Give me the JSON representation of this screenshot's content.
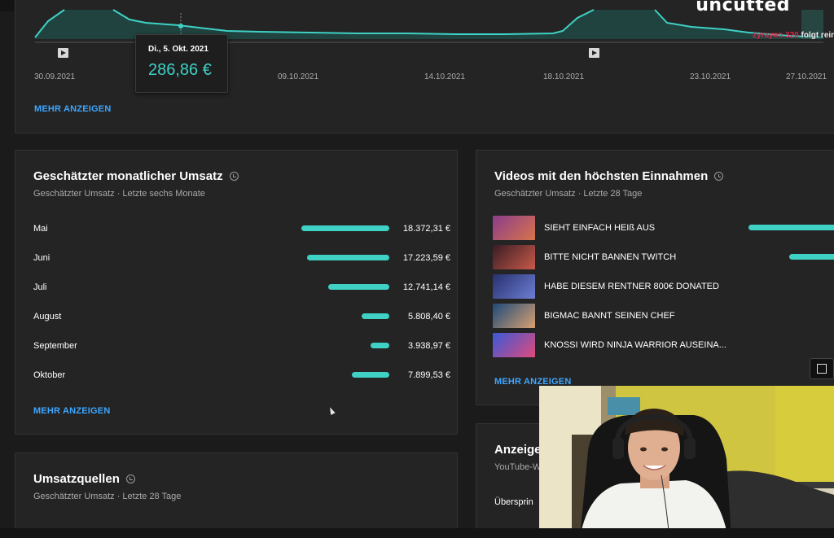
{
  "brand": {
    "name": "uncutted"
  },
  "revenue_chart": {
    "tooltip": {
      "date": "Di., 5. Okt. 2021",
      "value": "286,86 €"
    },
    "x_ticks": [
      "30.09.2021",
      "09.10.2021",
      "14.10.2021",
      "18.10.2021",
      "23.10.2021",
      "27.10.2021"
    ],
    "overlay": {
      "name": "zyrayen",
      "amount": "320",
      "suffix": "folgt rein"
    },
    "more_label": "MEHR ANZEIGEN"
  },
  "monthly_revenue": {
    "title": "Geschätzter monatlicher Umsatz",
    "subtitle": "Geschätzter Umsatz · Letzte sechs Monate",
    "more_label": "MEHR ANZEIGEN",
    "rows": [
      {
        "month": "Mai",
        "value_label": "18.372,31 €",
        "amount": 18372.31
      },
      {
        "month": "Juni",
        "value_label": "17.223,59 €",
        "amount": 17223.59
      },
      {
        "month": "Juli",
        "value_label": "12.741,14 €",
        "amount": 12741.14
      },
      {
        "month": "August",
        "value_label": "5.808,40 €",
        "amount": 5808.4
      },
      {
        "month": "September",
        "value_label": "3.938,97 €",
        "amount": 3938.97
      },
      {
        "month": "Oktober",
        "value_label": "7.899,53 €",
        "amount": 7899.53
      }
    ],
    "bar_color": "#3ed1c4"
  },
  "top_videos": {
    "title": "Videos mit den höchsten Einnahmen",
    "subtitle": "Geschätzter Umsatz · Letzte 28 Tage",
    "more_label": "MEHR ANZEIGEN",
    "items": [
      {
        "title": "SIEHT EINFACH HEIß AUS",
        "thumb": [
          "#8a3c8c",
          "#d8744a"
        ]
      },
      {
        "title": "BITTE NICHT BANNEN TWITCH",
        "thumb": [
          "#3a1c24",
          "#c85a4a"
        ]
      },
      {
        "title": "HABE DIESEM RENTNER 800€ DONATED",
        "thumb": [
          "#27306e",
          "#6d7fd4"
        ]
      },
      {
        "title": "BIGMAC BANNT SEINEN CHEF",
        "thumb": [
          "#1e4a7a",
          "#d8a070"
        ]
      },
      {
        "title": "KNOSSI WIRD NINJA WARRIOR AUSEINA...",
        "thumb": [
          "#3a5ad8",
          "#e04a7a"
        ]
      }
    ]
  },
  "revenue_sources": {
    "title": "Umsatzquellen",
    "subtitle": "Geschätzter Umsatz · Letzte 28 Tage"
  },
  "ads_card": {
    "title": "Anzeige",
    "subtitle": "YouTube-W",
    "row_label": "Übersprin"
  },
  "accent_color": "#3ed1c4",
  "link_color": "#3ea6ff"
}
